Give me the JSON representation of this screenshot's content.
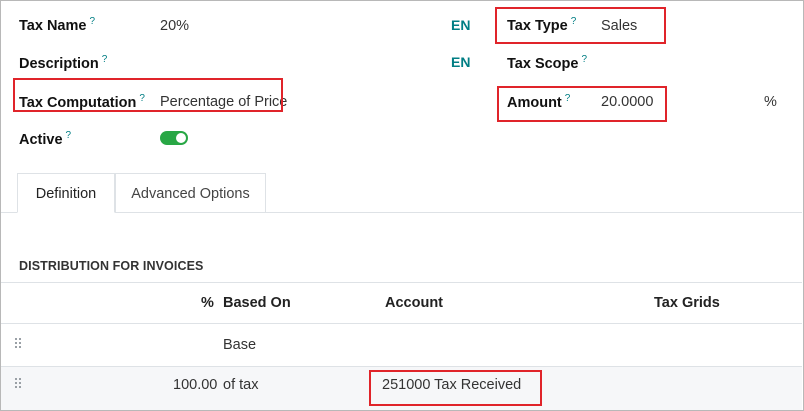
{
  "form": {
    "tax_name_label": "Tax Name",
    "tax_name_value": "20%",
    "description_label": "Description",
    "tax_computation_label": "Tax Computation",
    "tax_computation_value": "Percentage of Price",
    "active_label": "Active",
    "active_enabled": true,
    "lang_en_1": "EN",
    "lang_en_2": "EN",
    "tax_type_label": "Tax Type",
    "tax_type_value": "Sales",
    "tax_scope_label": "Tax Scope",
    "amount_label": "Amount",
    "amount_value": "20.0000",
    "amount_unit": "%",
    "help_marker": "?"
  },
  "tabs": [
    {
      "label": "Definition",
      "active": true
    },
    {
      "label": "Advanced Options",
      "active": false
    }
  ],
  "distribution": {
    "title": "DISTRIBUTION FOR INVOICES",
    "columns": [
      "%",
      "Based On",
      "Account",
      "Tax Grids"
    ],
    "rows": [
      {
        "percent": "",
        "based_on": "Base",
        "account": "",
        "tax_grids": ""
      },
      {
        "percent": "100.00",
        "based_on": "of tax",
        "account": "251000 Tax Received",
        "tax_grids": ""
      }
    ]
  },
  "colors": {
    "accent": "#017e84",
    "toggle_on": "#28a745",
    "highlight_box": "#e0242a"
  }
}
